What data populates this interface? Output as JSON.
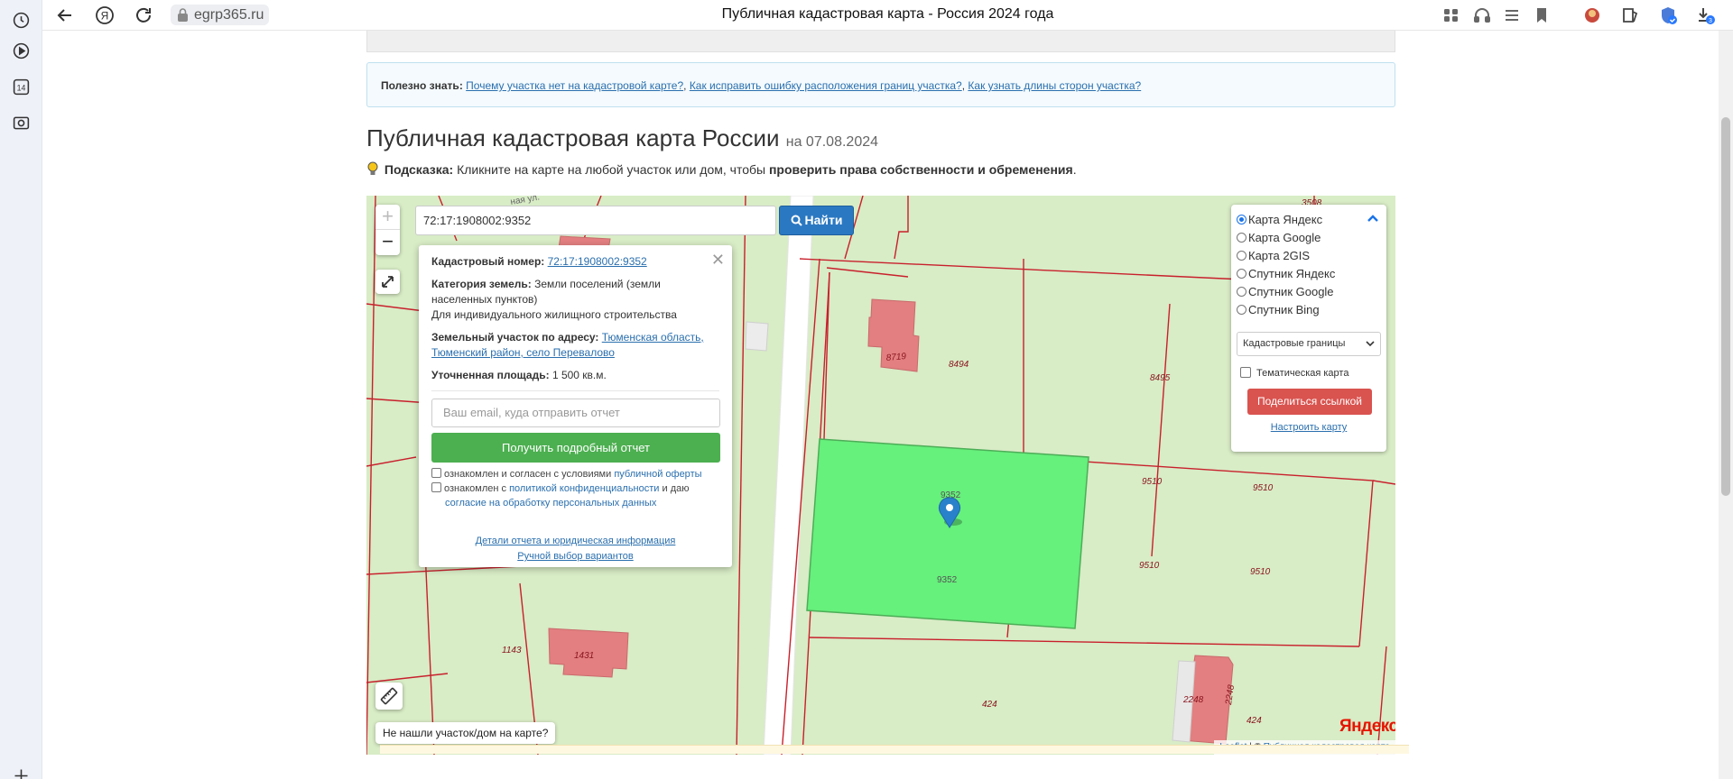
{
  "browser": {
    "url": "egrp365.ru",
    "tab_title": "Публичная кадастровая карта - Россия 2024 года",
    "rail_badge": "14",
    "download_badge": "3"
  },
  "info_box": {
    "label": "Полезно знать:",
    "link1": "Почему участка нет на кадастровой карте?",
    "link2": "Как исправить ошибку расположения границ участка?",
    "link3": "Как узнать длины сторон участка?",
    "sep": ","
  },
  "header": {
    "title": "Публичная кадастровая карта России",
    "date": "на 07.08.2024"
  },
  "hint": {
    "label": "Подсказка:",
    "text": "Кликните на карте на любой участок или дом, чтобы",
    "bold": "проверить права собственности и обременения",
    "end": "."
  },
  "map": {
    "zoom_in": "+",
    "zoom_out": "−",
    "search_value": "72:17:1908002:9352",
    "search_button": "Найти",
    "not_found": "Не нашли участок/дом на карте?",
    "yandex": "Яндекс",
    "attribution": {
      "leaflet": "Leaflet",
      "sep": "| ©",
      "source": "Публичная кадастровая карта"
    },
    "labels": {
      "l8719": "8719",
      "l8494": "8494",
      "l8495": "8495",
      "l9352": "9352",
      "l9352b": "9352",
      "l9510a": "9510",
      "l9510b": "9510",
      "l9510c": "9510",
      "l9510d": "9510",
      "l1143": "1143",
      "l1431": "1431",
      "l424a": "424",
      "l424b": "424",
      "l2248a": "2248",
      "l2248b": "2248",
      "l3508": "3508"
    }
  },
  "popup": {
    "cad_label": "Кадастровый номер:",
    "cad_value": "72:17:1908002:9352",
    "cat_label": "Категория земель:",
    "cat_value": "Земли поселений (земли населенных пунктов)",
    "use": "Для индивидуального жилищного строительства",
    "addr_label": "Земельный участок по адресу:",
    "addr_value": "Тюменская область, Тюменский район, село Перевалово",
    "area_label": "Уточненная площадь:",
    "area_value": "1 500 кв.м.",
    "email_placeholder": "Ваш email, куда отправить отчет",
    "report_button": "Получить подробный отчет",
    "chk1_text": "ознакомлен и согласен с условиями",
    "chk1_link": "публичной оферты",
    "chk2_text": "ознакомлен с",
    "chk2_link": "политикой конфиденциальности",
    "chk2_text2": "и даю",
    "chk2_link2": "согласие на обработку персональных данных",
    "details_link": "Детали отчета и юридическая информация",
    "manual_link": "Ручной выбор вариантов"
  },
  "layers": {
    "options": [
      "Карта Яндекс",
      "Карта Google",
      "Карта 2GIS",
      "Спутник Яндекс",
      "Спутник Google",
      "Спутник Bing"
    ],
    "selected": "Карта Яндекс",
    "overlay_select": "Кадастровые границы",
    "thematic": "Тематическая карта",
    "share_button": "Поделиться ссылкой",
    "setup_link": "Настроить карту"
  },
  "colors": {
    "map_bg": "#d8ecc6",
    "selected_parcel": "#66f07c",
    "parcel_border": "#c8202c",
    "building": "#e37f80",
    "search_btn": "#2b78c2",
    "report_btn": "#4caf50",
    "share_btn": "#d9534f"
  }
}
